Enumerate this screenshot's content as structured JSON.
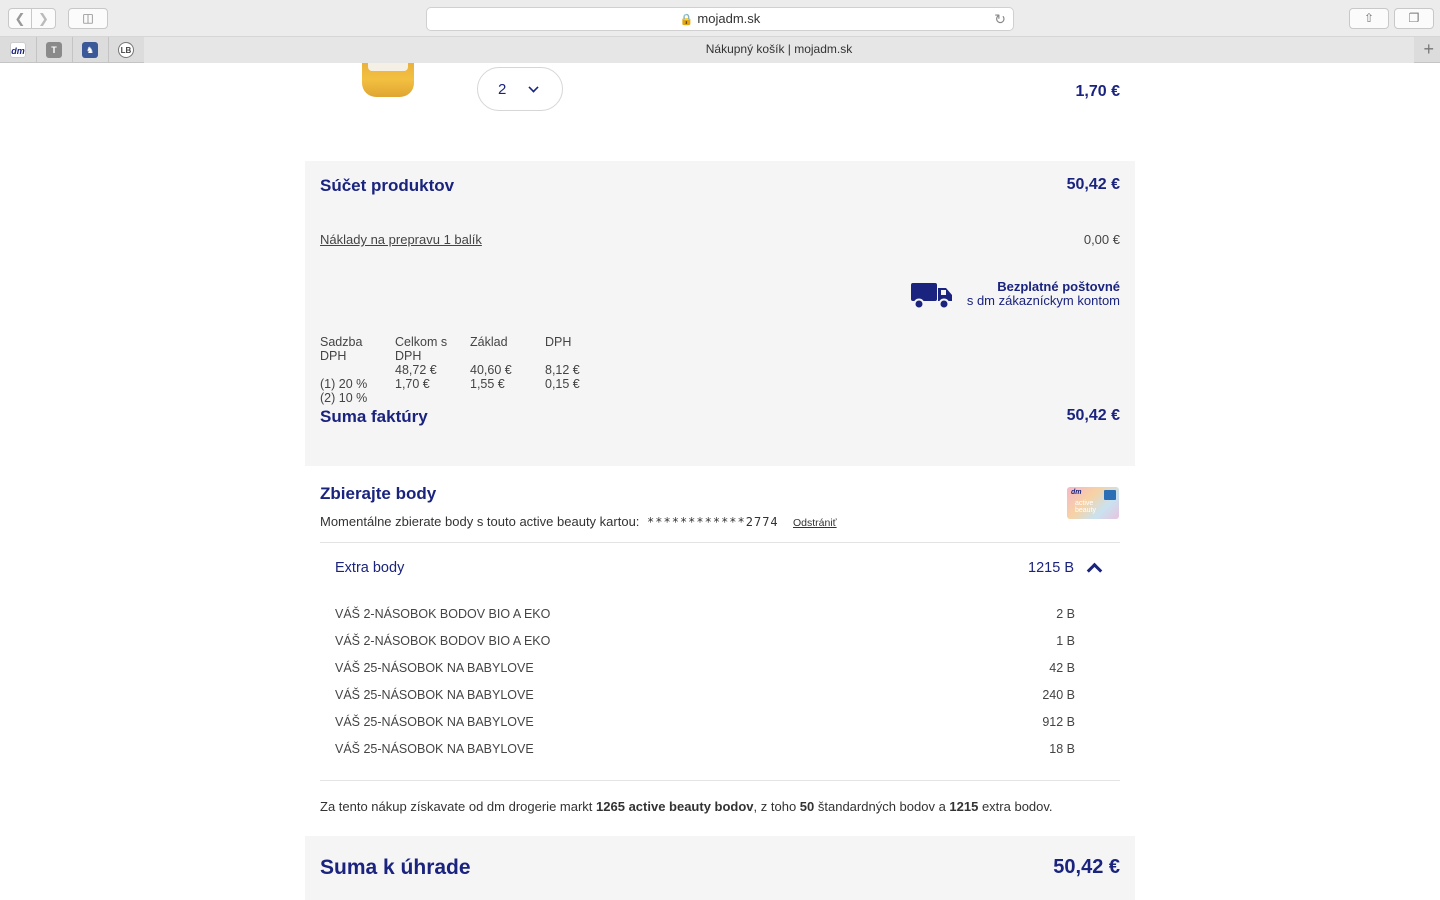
{
  "browser": {
    "url": "mojadm.sk",
    "tab_title": "Nákupný košík | mojadm.sk",
    "favicons": [
      "dm",
      "T",
      "horse",
      "LB"
    ]
  },
  "product": {
    "quantity": "2",
    "price": "1,70 €"
  },
  "summary": {
    "title": "Súčet produktov",
    "price": "50,42 €",
    "shipping_label": "Náklady na prepravu 1 balík",
    "shipping_price": "0,00 €",
    "free_shipping_line1": "Bezplatné poštovné",
    "free_shipping_line2": "s dm zákazníckym kontom",
    "vat_headers": [
      "Sadzba DPH",
      "Celkom s DPH",
      "Základ",
      "DPH"
    ],
    "vat_rows": [
      [
        "(1) 20 %",
        "48,72 €",
        "40,60 €",
        "8,12 €"
      ],
      [
        "(2) 10 %",
        "1,70 €",
        "1,55 €",
        "0,15 €"
      ]
    ],
    "invoice_label": "Suma faktúry",
    "invoice_price": "50,42 €"
  },
  "points": {
    "title": "Zbierajte body",
    "text": "Momentálne zbierate body s touto active beauty kartou:",
    "card_number": "************2774",
    "remove_label": "Odstrániť",
    "extra_title": "Extra body",
    "extra_total": "1215 B",
    "bonuses": [
      {
        "label": "VÁŠ 2-NÁSOBOK BODOV BIO A EKO",
        "value": "2 B"
      },
      {
        "label": "VÁŠ 2-NÁSOBOK BODOV BIO A EKO",
        "value": "1 B"
      },
      {
        "label": "VÁŠ 25-NÁSOBOK NA BABYLOVE",
        "value": "42 B"
      },
      {
        "label": "VÁŠ 25-NÁSOBOK NA BABYLOVE",
        "value": "240 B"
      },
      {
        "label": "VÁŠ 25-NÁSOBOK NA BABYLOVE",
        "value": "912 B"
      },
      {
        "label": "VÁŠ 25-NÁSOBOK NA BABYLOVE",
        "value": "18 B"
      }
    ],
    "info_prefix": "Za tento nákup získavate od dm drogerie markt ",
    "info_total": "1265 active beauty bodov",
    "info_mid1": ", z toho ",
    "info_standard": "50",
    "info_mid2": " štandardných bodov a ",
    "info_extra": "1215",
    "info_suffix": " extra bodov."
  },
  "payment": {
    "label": "Suma k úhrade",
    "price": "50,42 €"
  },
  "colors": {
    "brand_navy": "#1a237e",
    "panel_bg": "#f5f5f5"
  }
}
